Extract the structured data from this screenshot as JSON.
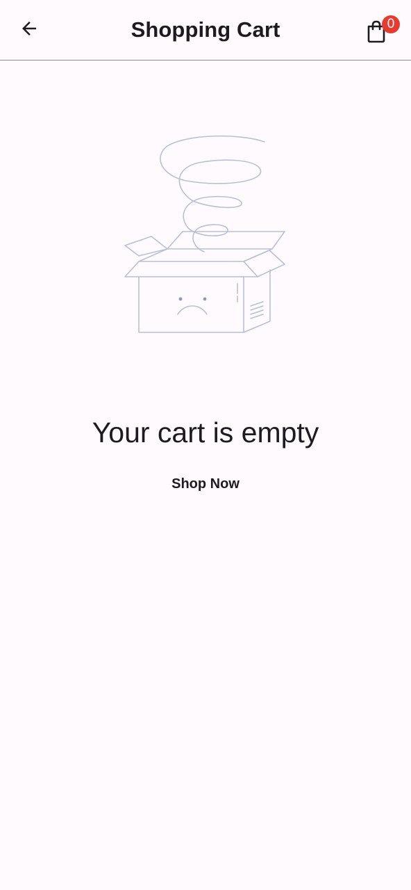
{
  "header": {
    "title": "Shopping Cart",
    "back_icon": "arrow-left-icon",
    "cart_icon": "shopping-bag-icon",
    "cart_count": "0",
    "badge_color": "#e63b2e"
  },
  "empty_state": {
    "illustration": "empty-box-illustration",
    "message": "Your cart is empty",
    "action_label": "Shop Now"
  },
  "colors": {
    "background": "#fefafd",
    "text": "#1d1b20",
    "illustration_stroke": "#b8c0d6"
  }
}
